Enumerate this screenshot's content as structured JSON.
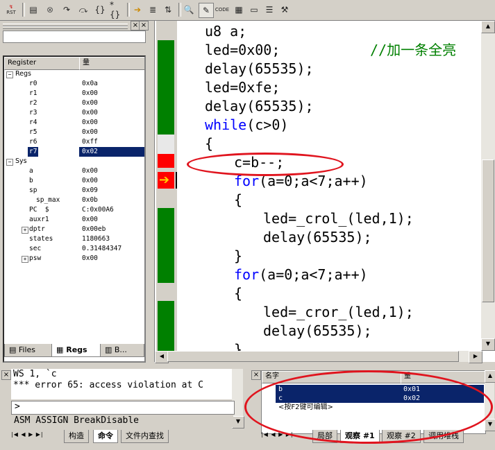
{
  "toolbar": {
    "rst_label": "RST",
    "buttons": [
      "reset-cpu",
      "run",
      "stop",
      "step-into",
      "step-over",
      "step-out",
      "run-to-cursor",
      "show-next-statement",
      "enable-trace",
      "view-trace",
      "disassembly",
      "watch",
      "code-coverage",
      "performance-analyzer",
      "logic-analyzer",
      "memory-window",
      "toolbox"
    ]
  },
  "register_panel": {
    "col_register": "Register",
    "col_value": "量",
    "groups": [
      {
        "name": "Regs",
        "items": [
          {
            "name": "r0",
            "value": "0x0a"
          },
          {
            "name": "r1",
            "value": "0x00"
          },
          {
            "name": "r2",
            "value": "0x00"
          },
          {
            "name": "r3",
            "value": "0x00"
          },
          {
            "name": "r4",
            "value": "0x00"
          },
          {
            "name": "r5",
            "value": "0x00"
          },
          {
            "name": "r6",
            "value": "0xff"
          },
          {
            "name": "r7",
            "value": "0x02"
          }
        ]
      },
      {
        "name": "Sys",
        "items": [
          {
            "name": "a",
            "value": "0x00"
          },
          {
            "name": "b",
            "value": "0x00"
          },
          {
            "name": "sp",
            "value": "0x09"
          },
          {
            "name": "sp_max",
            "value": "0x0b"
          },
          {
            "name": "PC  $",
            "value": "C:0x00A6"
          },
          {
            "name": "auxr1",
            "value": "0x00"
          },
          {
            "name": "dptr",
            "value": "0x00eb"
          },
          {
            "name": "states",
            "value": "1180663"
          },
          {
            "name": "sec",
            "value": "0.31484347"
          },
          {
            "name": "psw",
            "value": "0x00"
          }
        ]
      }
    ],
    "tabs": [
      "Files",
      "Regs",
      "B..."
    ]
  },
  "editor": {
    "lines": [
      {
        "indent": 0,
        "text": "u8 a;",
        "kw": "",
        "rest": "",
        "comment": ""
      },
      {
        "indent": 0,
        "text": "led=0x00;",
        "kw": "",
        "rest": "",
        "comment": "//加一条全亮"
      },
      {
        "indent": 0,
        "text": "delay(65535);",
        "kw": "",
        "rest": "",
        "comment": ""
      },
      {
        "indent": 0,
        "text": "led=0xfe;",
        "kw": "",
        "rest": "",
        "comment": ""
      },
      {
        "indent": 0,
        "text": "delay(65535);",
        "kw": "",
        "rest": "",
        "comment": ""
      },
      {
        "indent": 0,
        "text": "",
        "kw": "while",
        "rest": "(c>0)",
        "comment": ""
      },
      {
        "indent": 0,
        "text": "{",
        "kw": "",
        "rest": "",
        "comment": ""
      },
      {
        "indent": 1,
        "text": "c=b--;",
        "kw": "",
        "rest": "",
        "comment": ""
      },
      {
        "indent": 1,
        "text": "",
        "kw": "for",
        "rest": "(a=0;a<7;a++)",
        "comment": ""
      },
      {
        "indent": 1,
        "text": "{",
        "kw": "",
        "rest": "",
        "comment": ""
      },
      {
        "indent": 2,
        "text": "led=_crol_(led,1);",
        "kw": "",
        "rest": "",
        "comment": ""
      },
      {
        "indent": 2,
        "text": "delay(65535);",
        "kw": "",
        "rest": "",
        "comment": ""
      },
      {
        "indent": 1,
        "text": "}",
        "kw": "",
        "rest": "",
        "comment": ""
      },
      {
        "indent": 1,
        "text": "",
        "kw": "for",
        "rest": "(a=0;a<7;a++)",
        "comment": ""
      },
      {
        "indent": 1,
        "text": "{",
        "kw": "",
        "rest": "",
        "comment": ""
      },
      {
        "indent": 2,
        "text": "led=_cror_(led,1);",
        "kw": "",
        "rest": "",
        "comment": ""
      },
      {
        "indent": 2,
        "text": "delay(65535);",
        "kw": "",
        "rest": "",
        "comment": ""
      },
      {
        "indent": 1,
        "text": "}",
        "kw": "",
        "rest": "",
        "comment": ""
      }
    ]
  },
  "output": {
    "line1": "WS 1, `c",
    "line2": "*** error 65: access violation at C",
    "prompt": ">",
    "status": "ASM ASSIGN BreakDisable",
    "tabs": [
      "构造",
      "命令",
      "文件内查找"
    ]
  },
  "watch": {
    "col_name": "名字",
    "col_value": "量",
    "rows": [
      {
        "name": "b",
        "value": "0x01"
      },
      {
        "name": "c",
        "value": "0x02"
      }
    ],
    "edit_hint": "<按F2键可编辑>",
    "tabs": [
      "局部",
      "观察 #1",
      "观察 #2",
      "调用堆栈"
    ]
  }
}
